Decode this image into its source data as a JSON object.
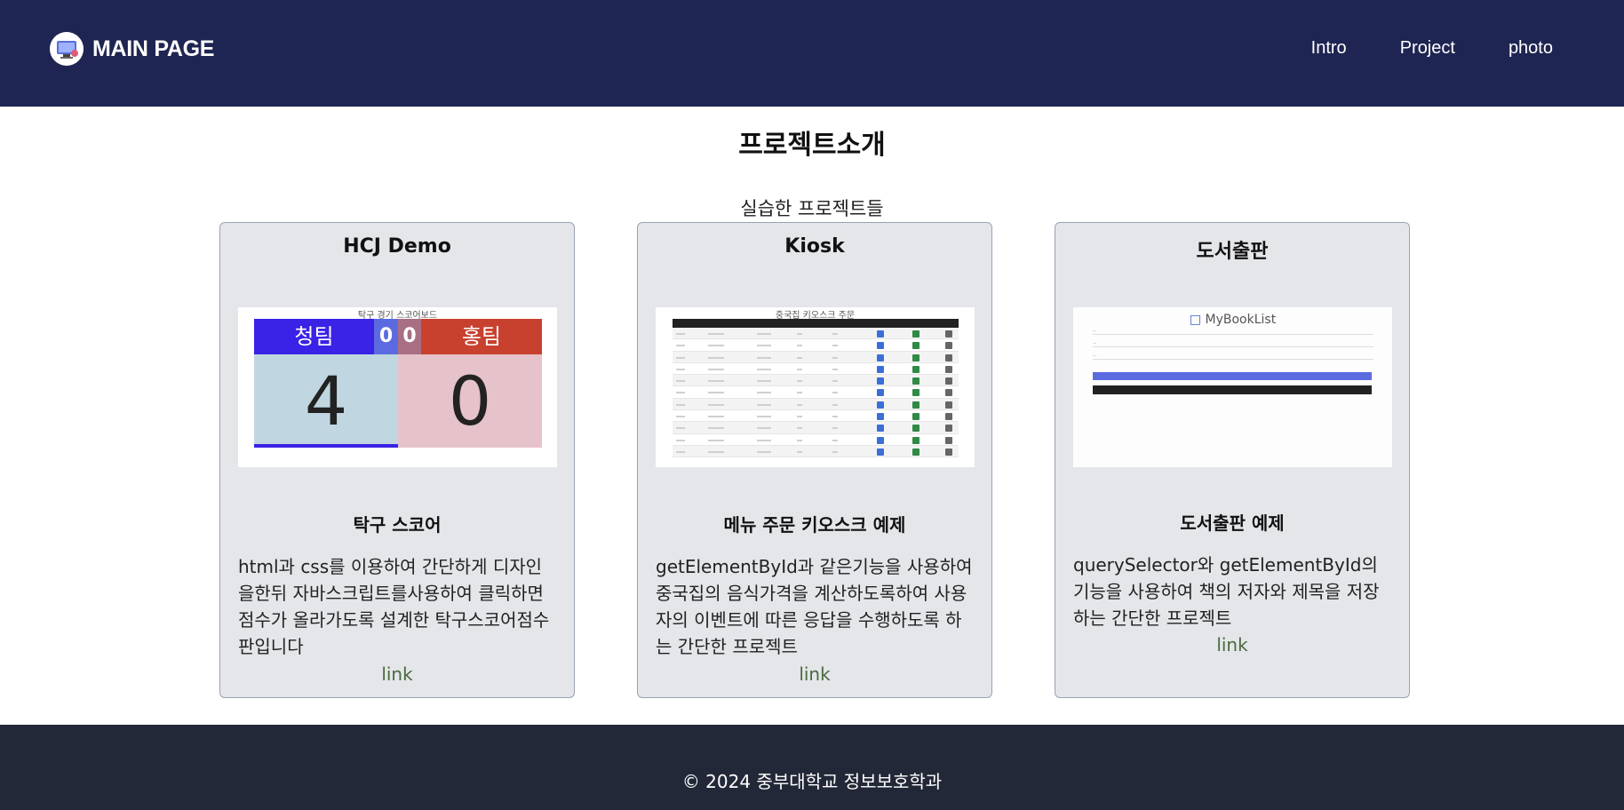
{
  "header": {
    "brand": "MAIN PAGE",
    "logo_icon": "monitor-logo-icon",
    "nav": [
      "Intro",
      "Project",
      "photo"
    ],
    "background": "#1f2552"
  },
  "main": {
    "title": "프로젝트소개",
    "subtitle": "실습한 프로젝트들"
  },
  "cards": [
    {
      "title": "HCJ Demo",
      "heading": "탁구 스코어",
      "description": "html과 css를 이용하여 간단하게 디자인을한뒤 자바스크립트를사용하여 클릭하면 점수가 올라가도록 설계한 탁구스코어점수판입니다",
      "link": "link",
      "thumbnail": {
        "caption": "탁구 경기 스코어보드",
        "blue_team": "청팀",
        "red_team": "홍팀",
        "blue_set": "0",
        "red_set": "0",
        "blue_score": "4",
        "red_score": "0"
      }
    },
    {
      "title": "Kiosk",
      "heading": "메뉴 주문 키오스크 예제",
      "description": "getElementById과 같은기능을 사용하여 중국집의 음식가격을 계산하도록하여 사용자의 이벤트에 따른 응답을 수행하도록 하는 간단한 프로젝트",
      "link": "link",
      "thumbnail": {
        "caption": "중국집 키오스크 주문"
      }
    },
    {
      "title": "도서출판",
      "heading": "도서출판 예제",
      "description": "querySelector와 getElementById의 기능을 사용하여 책의 저자와 제목을 저장하는 간단한 프로젝트",
      "link": "link",
      "thumbnail": {
        "app_title": "MyBookList"
      }
    }
  ],
  "footer": {
    "text": "© 2024 중부대학교 정보보호학과",
    "background": "#232838"
  },
  "colors": {
    "link": "#4a6a3f",
    "card_bg": "#e4e6ea"
  }
}
